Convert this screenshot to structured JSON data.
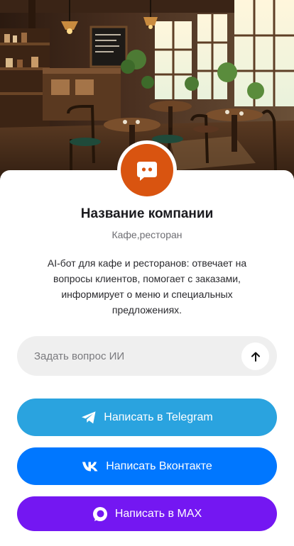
{
  "company": {
    "name": "Название компании",
    "category": "Кафе,ресторан",
    "description": "AI-бот для кафе и ресторанов: отвечает на вопросы клиентов, помогает с заказами, информирует о меню и специальных предложениях."
  },
  "ask": {
    "placeholder": "Задать вопрос ИИ",
    "value": "",
    "send_icon": "arrow-up-icon"
  },
  "buttons": {
    "telegram": {
      "label": "Написать в Telegram",
      "icon": "telegram-icon",
      "color": "#2aa3df"
    },
    "vk": {
      "label": "Написать Вконтакте",
      "icon": "vk-icon",
      "color": "#0077ff"
    },
    "max": {
      "label": "Написать в MAX",
      "icon": "max-icon",
      "color": "#7417f2"
    }
  },
  "brand": {
    "avatar_color": "#d95410",
    "avatar_icon": "chat-bot-icon"
  }
}
